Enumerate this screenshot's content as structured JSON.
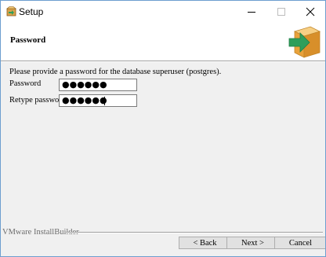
{
  "window": {
    "title": "Setup"
  },
  "titlebar_icons": {
    "app": "setup-app-icon",
    "minimize": "minimize-icon",
    "maximize": "maximize-icon",
    "close": "close-icon"
  },
  "header": {
    "title": "Password",
    "logo": "install-box-arrow-icon"
  },
  "content": {
    "instruction": "Please provide a password for the database superuser (postgres).",
    "password_label": "Password",
    "password_value": "●●●●●●",
    "retype_label": "Retype password",
    "retype_value": "●●●●●●"
  },
  "footer": {
    "brand": "VMware InstallBuilder",
    "back_label": "< Back",
    "next_label": "Next >",
    "cancel_label": "Cancel"
  },
  "colors": {
    "window_border": "#6d9ecf",
    "arrow_green": "#2e9e5b",
    "box_orange": "#e9a23b"
  }
}
